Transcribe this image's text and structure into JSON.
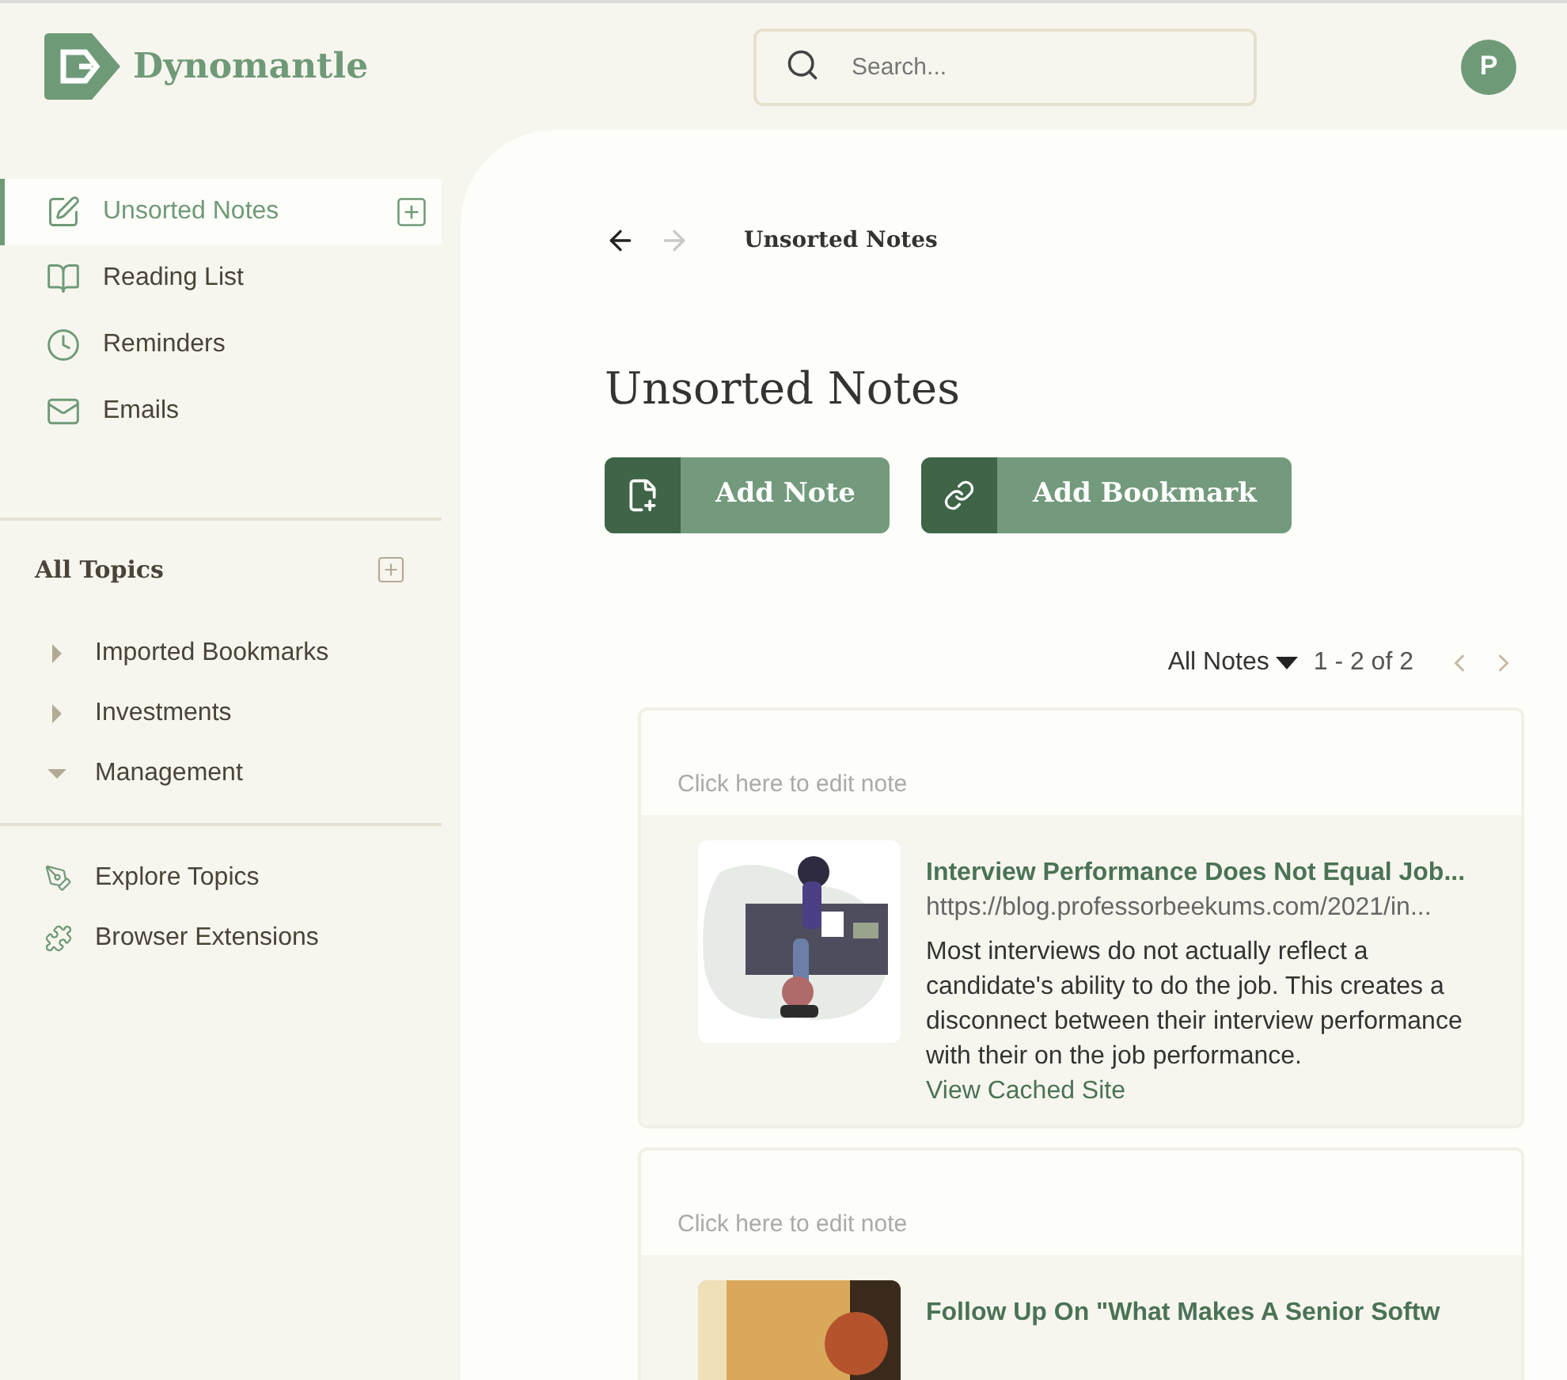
{
  "header": {
    "logo": "Dynomantle",
    "search": {
      "placeholder": "Search..."
    },
    "avatar": "P"
  },
  "sidebar": {
    "items": [
      {
        "label": "Unsorted Notes",
        "selected": true
      },
      {
        "label": "Reading List",
        "selected": false
      },
      {
        "label": "Reminders",
        "selected": false
      },
      {
        "label": "Emails",
        "selected": false
      }
    ],
    "topics_title": "All Topics",
    "topics": [
      {
        "label": "Imported Bookmarks",
        "expanded": false
      },
      {
        "label": "Investments",
        "expanded": false
      },
      {
        "label": "Management",
        "expanded": true
      }
    ],
    "links": [
      {
        "label": "Explore Topics"
      },
      {
        "label": "Browser Extensions"
      }
    ]
  },
  "main": {
    "breadcrumb": "Unsorted Notes",
    "title": "Unsorted Notes",
    "buttons": [
      {
        "label": "Add Note"
      },
      {
        "label": "Add Bookmark"
      }
    ],
    "filter": "All Notes",
    "range": "1 - 2 of 2",
    "notes": [
      {
        "placeholder": "Click here to edit note",
        "title": "Interview Performance Does Not Equal Job...",
        "url": "https://blog.professorbeekums.com/2021/in...",
        "description": "Most interviews do not actually reflect a candidate's ability to do the job. This creates a disconnect between their interview performance with their on the job performance.",
        "link": "View Cached Site"
      },
      {
        "placeholder": "Click here to edit note",
        "title": "Follow Up On \"What Makes A Senior Softw"
      }
    ]
  }
}
